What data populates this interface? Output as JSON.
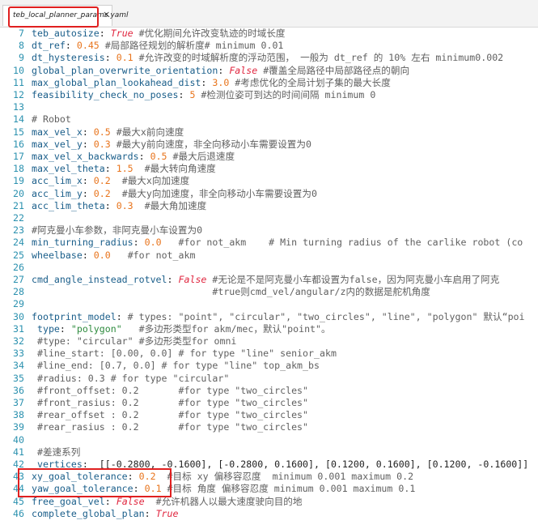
{
  "tab": {
    "title": "teb_local_planner_params.yaml",
    "close": "×"
  },
  "lines": [
    {
      "n": "7",
      "t": [
        [
          "k",
          "teb_autosize"
        ],
        [
          "p",
          ": "
        ],
        [
          "b",
          "True"
        ],
        [
          "c",
          " #优化期间允许改变轨迹的时域长度"
        ]
      ]
    },
    {
      "n": "8",
      "t": [
        [
          "k",
          "dt_ref"
        ],
        [
          "p",
          ": "
        ],
        [
          "n",
          "0.45"
        ],
        [
          "c",
          " #局部路径规划的解析度# minimum 0.01"
        ]
      ]
    },
    {
      "n": "9",
      "t": [
        [
          "k",
          "dt_hysteresis"
        ],
        [
          "p",
          ": "
        ],
        [
          "n",
          "0.1"
        ],
        [
          "c",
          " #允许改变的时域解析度的浮动范围， 一般为 dt_ref 的 10% 左右 minimum0.002"
        ]
      ]
    },
    {
      "n": "10",
      "t": [
        [
          "k",
          "global_plan_overwrite_orientation"
        ],
        [
          "p",
          ": "
        ],
        [
          "b",
          "False"
        ],
        [
          "c",
          " #覆盖全局路径中局部路径点的朝向"
        ]
      ]
    },
    {
      "n": "11",
      "t": [
        [
          "k",
          "max_global_plan_lookahead_dist"
        ],
        [
          "p",
          ": "
        ],
        [
          "n",
          "3.0"
        ],
        [
          "c",
          " #考虑优化的全局计划子集的最大长度"
        ]
      ]
    },
    {
      "n": "12",
      "t": [
        [
          "k",
          "feasibility_check_no_poses"
        ],
        [
          "p",
          ": "
        ],
        [
          "n",
          "5"
        ],
        [
          "c",
          " #检测位姿可到达的时间间隔 minimum 0"
        ]
      ]
    },
    {
      "n": "13",
      "t": []
    },
    {
      "n": "14",
      "t": [
        [
          "c",
          "# Robot"
        ]
      ]
    },
    {
      "n": "15",
      "t": [
        [
          "k",
          "max_vel_x"
        ],
        [
          "p",
          ": "
        ],
        [
          "n",
          "0.5"
        ],
        [
          "c",
          " #最大x前向速度"
        ]
      ]
    },
    {
      "n": "16",
      "t": [
        [
          "k",
          "max_vel_y"
        ],
        [
          "p",
          ": "
        ],
        [
          "n",
          "0.3"
        ],
        [
          "c",
          " #最大y前向速度，非全向移动小车需要设置为0"
        ]
      ]
    },
    {
      "n": "17",
      "t": [
        [
          "k",
          "max_vel_x_backwards"
        ],
        [
          "p",
          ": "
        ],
        [
          "n",
          "0.5"
        ],
        [
          "c",
          " #最大后退速度"
        ]
      ]
    },
    {
      "n": "18",
      "t": [
        [
          "k",
          "max_vel_theta"
        ],
        [
          "p",
          ": "
        ],
        [
          "n",
          "1.5"
        ],
        [
          "c",
          "  #最大转向角速度"
        ]
      ]
    },
    {
      "n": "19",
      "t": [
        [
          "k",
          "acc_lim_x"
        ],
        [
          "p",
          ": "
        ],
        [
          "n",
          "0.2"
        ],
        [
          "c",
          "  #最大x向加速度"
        ]
      ]
    },
    {
      "n": "20",
      "t": [
        [
          "k",
          "acc_lim_y"
        ],
        [
          "p",
          ": "
        ],
        [
          "n",
          "0.2"
        ],
        [
          "c",
          "  #最大y向加速度，非全向移动小车需要设置为0"
        ]
      ]
    },
    {
      "n": "21",
      "t": [
        [
          "k",
          "acc_lim_theta"
        ],
        [
          "p",
          ": "
        ],
        [
          "n",
          "0.3"
        ],
        [
          "c",
          "  #最大角加速度"
        ]
      ]
    },
    {
      "n": "22",
      "t": []
    },
    {
      "n": "23",
      "t": [
        [
          "c",
          "#阿克曼小车参数，非阿克曼小车设置为0"
        ]
      ]
    },
    {
      "n": "24",
      "t": [
        [
          "k",
          "min_turning_radius"
        ],
        [
          "p",
          ": "
        ],
        [
          "n",
          "0.0"
        ],
        [
          "c",
          "   #for not_akm    # Min turning radius of the carlike robot (co"
        ]
      ]
    },
    {
      "n": "25",
      "t": [
        [
          "k",
          "wheelbase"
        ],
        [
          "p",
          ": "
        ],
        [
          "n",
          "0.0"
        ],
        [
          "c",
          "   #for not_akm"
        ]
      ]
    },
    {
      "n": "26",
      "t": []
    },
    {
      "n": "27",
      "t": [
        [
          "k",
          "cmd_angle_instead_rotvel"
        ],
        [
          "p",
          ": "
        ],
        [
          "b",
          "False"
        ],
        [
          "c",
          " #无论是不是阿克曼小车都设置为false，因为阿克曼小车启用了阿克"
        ]
      ]
    },
    {
      "n": "28",
      "t": [
        [
          "c",
          "                                #true则cmd_vel/angular/z内的数据是舵机角度"
        ]
      ]
    },
    {
      "n": "29",
      "t": []
    },
    {
      "n": "30",
      "t": [
        [
          "k",
          "footprint_model"
        ],
        [
          "p",
          ": "
        ],
        [
          "c",
          "# types: \"point\", \"circular\", \"two_circles\", \"line\", \"polygon\" 默认“poi"
        ]
      ]
    },
    {
      "n": "31",
      "t": [
        [
          "k",
          " type"
        ],
        [
          "p",
          ": "
        ],
        [
          "s",
          "\"polygon\""
        ],
        [
          "c",
          "   #多边形类型for akm/mec，默认\"point\"。"
        ]
      ]
    },
    {
      "n": "32",
      "t": [
        [
          "c",
          " #type: \"circular\" #多边形类型for omni"
        ]
      ]
    },
    {
      "n": "33",
      "t": [
        [
          "c",
          " #line_start: [0.00, 0.0] # for type \"line\" senior_akm"
        ]
      ]
    },
    {
      "n": "34",
      "t": [
        [
          "c",
          " #line_end: [0.7, 0.0] # for type \"line\" top_akm_bs"
        ]
      ]
    },
    {
      "n": "35",
      "t": [
        [
          "c",
          " #radius: 0.3 # for type \"circular\""
        ]
      ]
    },
    {
      "n": "36",
      "t": [
        [
          "c",
          " #front_offset: 0.2       #for type \"two_circles\""
        ]
      ]
    },
    {
      "n": "37",
      "t": [
        [
          "c",
          " #front_rasius: 0.2       #for type \"two_circles\""
        ]
      ]
    },
    {
      "n": "38",
      "t": [
        [
          "c",
          " #rear_offset : 0.2       #for type \"two_circles\""
        ]
      ]
    },
    {
      "n": "39",
      "t": [
        [
          "c",
          " #rear_rasius : 0.2       #for type \"two_circles\""
        ]
      ]
    },
    {
      "n": "40",
      "t": []
    },
    {
      "n": "41",
      "t": [
        [
          "c",
          " #差速系列"
        ]
      ]
    },
    {
      "n": "42",
      "t": [
        [
          "k",
          " vertices"
        ],
        [
          "p",
          ":  [[-0.2800, -0.1600], [-0.2800, 0.1600], [0.1200, 0.1600], [0.1200, -0.1600]]"
        ]
      ]
    },
    {
      "n": "43",
      "t": [
        [
          "k",
          "xy_goal_tolerance"
        ],
        [
          "p",
          ": "
        ],
        [
          "n",
          "0.2"
        ],
        [
          "c",
          "  #目标 xy 偏移容忍度  minimum 0.001 maximum 0.2"
        ]
      ]
    },
    {
      "n": "44",
      "t": [
        [
          "k",
          "yaw_goal_tolerance"
        ],
        [
          "p",
          ": "
        ],
        [
          "n",
          "0.1"
        ],
        [
          "c",
          " #目标 角度 偏移容忍度 minimum 0.001 maximum 0.1"
        ]
      ]
    },
    {
      "n": "45",
      "t": [
        [
          "k",
          "free_goal_vel"
        ],
        [
          "p",
          ": "
        ],
        [
          "b",
          "False"
        ],
        [
          "c",
          "  #允许机器人以最大速度驶向目的地"
        ]
      ]
    },
    {
      "n": "46",
      "t": [
        [
          "k",
          "complete_global_plan"
        ],
        [
          "p",
          ": "
        ],
        [
          "b",
          "True"
        ]
      ]
    }
  ]
}
